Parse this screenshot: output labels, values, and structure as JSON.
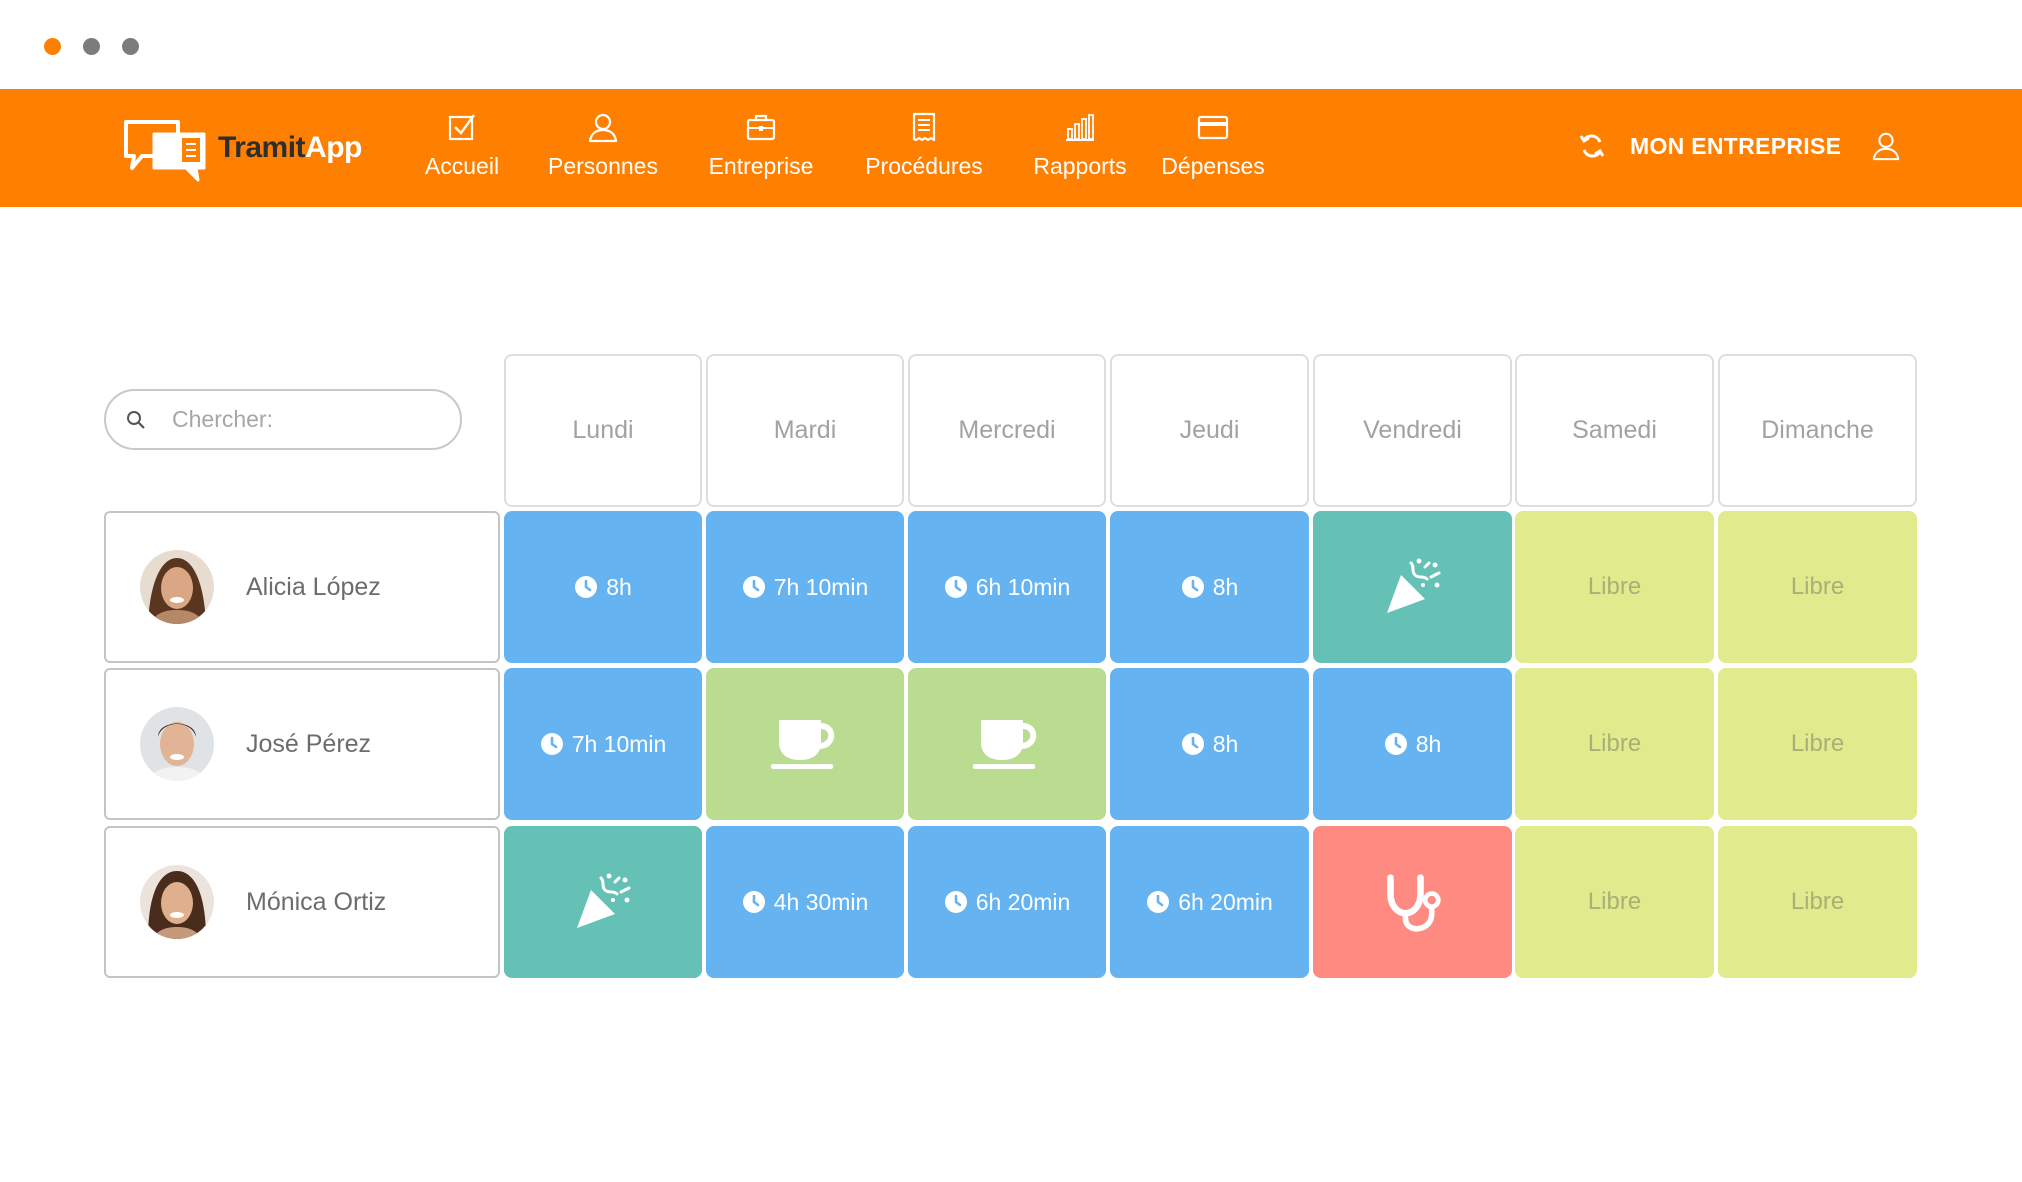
{
  "window": {
    "controls": [
      "close",
      "minimize",
      "maximize"
    ]
  },
  "brand": {
    "name_part1": "Tramit",
    "name_part2": "App",
    "color": "#ff7f00"
  },
  "nav": {
    "items": [
      {
        "label": "Accueil",
        "icon": "checkbox-icon"
      },
      {
        "label": "Personnes",
        "icon": "person-icon"
      },
      {
        "label": "Entreprise",
        "icon": "briefcase-icon"
      },
      {
        "label": "Procédures",
        "icon": "receipt-icon"
      },
      {
        "label": "Rapports",
        "icon": "bar-chart-icon"
      },
      {
        "label": "Dépenses",
        "icon": "credit-card-icon"
      }
    ],
    "company_label": "MON ENTREPRISE"
  },
  "search": {
    "placeholder": "Chercher:"
  },
  "days": [
    "Lundi",
    "Mardi",
    "Mercredi",
    "Jeudi",
    "Vendredi",
    "Samedi",
    "Dimanche"
  ],
  "employees": [
    {
      "name": "Alicia López",
      "schedule": [
        {
          "type": "work",
          "text": "8h"
        },
        {
          "type": "work",
          "text": "7h 10min"
        },
        {
          "type": "work",
          "text": "6h 10min"
        },
        {
          "type": "work",
          "text": "8h"
        },
        {
          "type": "holiday",
          "icon": "party-popper-icon"
        },
        {
          "type": "free",
          "text": "Libre"
        },
        {
          "type": "free",
          "text": "Libre"
        }
      ]
    },
    {
      "name": "José Pérez",
      "schedule": [
        {
          "type": "work",
          "text": "7h 10min"
        },
        {
          "type": "off",
          "icon": "coffee-cup-icon"
        },
        {
          "type": "off",
          "icon": "coffee-cup-icon"
        },
        {
          "type": "work",
          "text": "8h"
        },
        {
          "type": "work",
          "text": "8h"
        },
        {
          "type": "free",
          "text": "Libre"
        },
        {
          "type": "free",
          "text": "Libre"
        }
      ]
    },
    {
      "name": "Mónica Ortiz",
      "schedule": [
        {
          "type": "holiday",
          "icon": "party-popper-icon"
        },
        {
          "type": "work",
          "text": "4h 30min"
        },
        {
          "type": "work",
          "text": "6h 20min"
        },
        {
          "type": "work",
          "text": "6h 20min"
        },
        {
          "type": "sick",
          "icon": "stethoscope-icon"
        },
        {
          "type": "free",
          "text": "Libre"
        },
        {
          "type": "free",
          "text": "Libre"
        }
      ]
    }
  ],
  "colors": {
    "work": "#65b3f0",
    "holiday": "#65c1b6",
    "off": "#b9dc90",
    "free": "#e1ea8c",
    "sick": "#ff8a82"
  }
}
